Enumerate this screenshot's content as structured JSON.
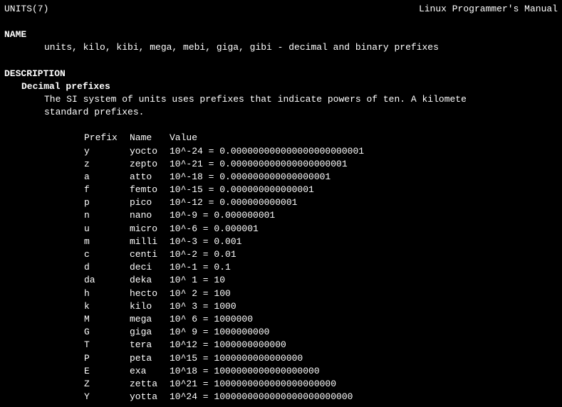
{
  "header": {
    "left": "UNITS(7)",
    "right": "Linux Programmer's Manual"
  },
  "sections": {
    "name": {
      "heading": "NAME",
      "content": "units, kilo, kibi, mega, mebi, giga, gibi - decimal and binary prefixes"
    },
    "description": {
      "heading": "DESCRIPTION",
      "sub_heading": "Decimal prefixes",
      "paragraph_line1": "The  SI  system  of  units uses prefixes that indicate powers of ten.  A kilomete",
      "paragraph_line2": "standard prefixes."
    }
  },
  "table": {
    "headers": {
      "prefix": "Prefix",
      "name": "Name",
      "value": "Value"
    },
    "rows": [
      {
        "prefix": "y",
        "name": "yocto",
        "value": "10^-24 = 0.000000000000000000000001"
      },
      {
        "prefix": "z",
        "name": "zepto",
        "value": "10^-21 = 0.000000000000000000001"
      },
      {
        "prefix": "a",
        "name": "atto",
        "value": "10^-18 = 0.000000000000000001"
      },
      {
        "prefix": "f",
        "name": "femto",
        "value": "10^-15 = 0.000000000000001"
      },
      {
        "prefix": "p",
        "name": "pico",
        "value": "10^-12 = 0.000000000001"
      },
      {
        "prefix": "n",
        "name": "nano",
        "value": "10^-9  = 0.000000001"
      },
      {
        "prefix": "u",
        "name": "micro",
        "value": "10^-6  = 0.000001"
      },
      {
        "prefix": "m",
        "name": "milli",
        "value": "10^-3  = 0.001"
      },
      {
        "prefix": "c",
        "name": "centi",
        "value": "10^-2  = 0.01"
      },
      {
        "prefix": "d",
        "name": "deci",
        "value": "10^-1  = 0.1"
      },
      {
        "prefix": "da",
        "name": "deka",
        "value": "10^ 1  = 10"
      },
      {
        "prefix": "h",
        "name": "hecto",
        "value": "10^ 2  = 100"
      },
      {
        "prefix": "k",
        "name": "kilo",
        "value": "10^ 3  = 1000"
      },
      {
        "prefix": "M",
        "name": "mega",
        "value": "10^ 6  = 1000000"
      },
      {
        "prefix": "G",
        "name": "giga",
        "value": "10^ 9  = 1000000000"
      },
      {
        "prefix": "T",
        "name": "tera",
        "value": "10^12  = 1000000000000"
      },
      {
        "prefix": "P",
        "name": "peta",
        "value": "10^15  = 1000000000000000"
      },
      {
        "prefix": "E",
        "name": "exa",
        "value": "10^18  = 1000000000000000000"
      },
      {
        "prefix": "Z",
        "name": "zetta",
        "value": "10^21  = 1000000000000000000000"
      },
      {
        "prefix": "Y",
        "name": "yotta",
        "value": "10^24  = 1000000000000000000000000"
      }
    ]
  }
}
